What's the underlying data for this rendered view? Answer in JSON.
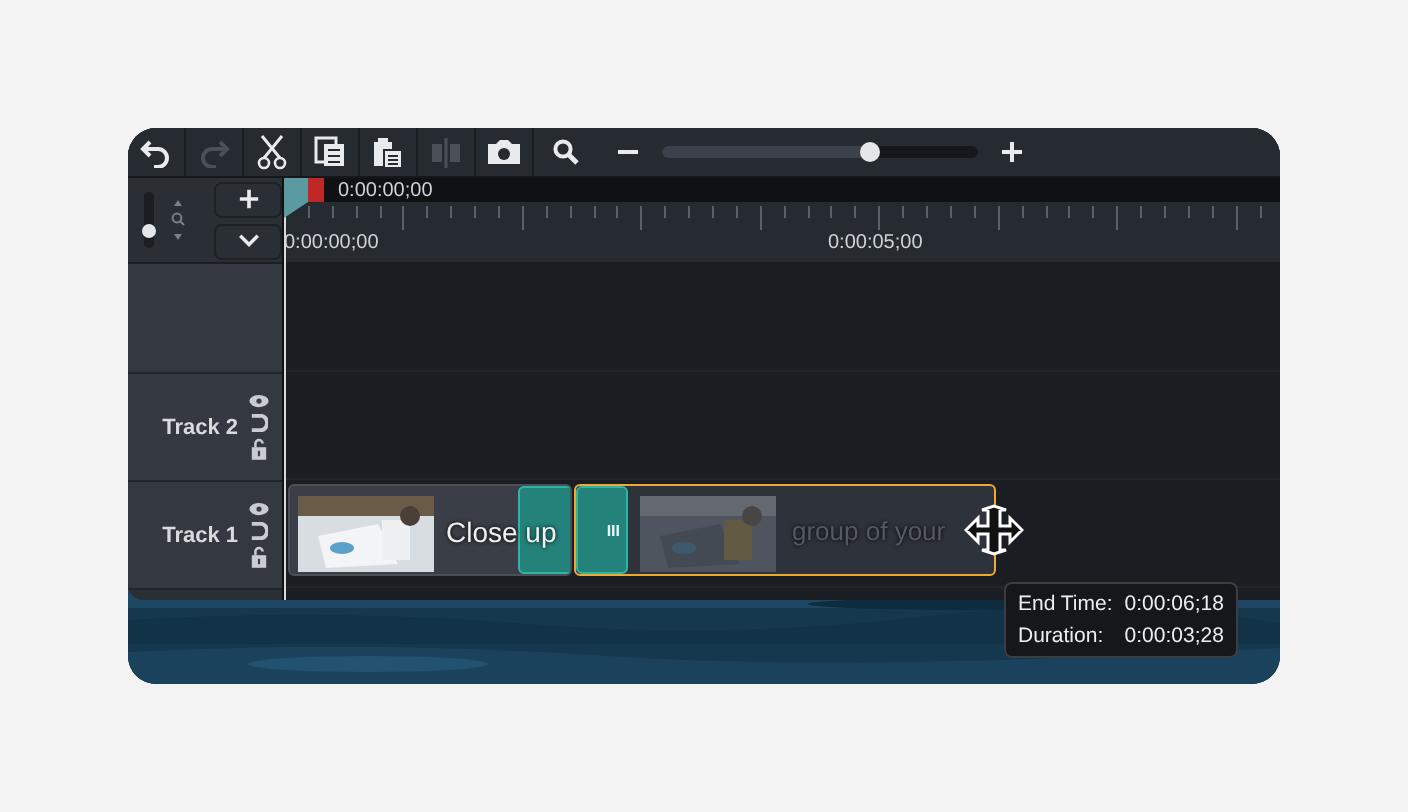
{
  "toolbar": {
    "tools": [
      {
        "kind": "undo",
        "disabled": false
      },
      {
        "kind": "redo",
        "disabled": true
      },
      {
        "kind": "cut",
        "disabled": false
      },
      {
        "kind": "copy",
        "disabled": false
      },
      {
        "kind": "paste",
        "disabled": false
      },
      {
        "kind": "split",
        "disabled": true
      },
      {
        "kind": "snapshot",
        "disabled": false
      }
    ],
    "zoom": {
      "level": 0.66
    }
  },
  "track_height": {
    "level": 0.3
  },
  "playhead": {
    "time": "0:00:00;00"
  },
  "ruler": {
    "labels": [
      "0:00:00;00",
      "0:00:05;00"
    ]
  },
  "tracks": [
    {
      "name": "Track 2"
    },
    {
      "name": "Track 1",
      "clips": [
        {
          "label": "Close up",
          "selected": false
        },
        {
          "label": "group of your",
          "selected": true,
          "transition_mark": "III"
        }
      ]
    }
  ],
  "tooltip": {
    "rows": [
      {
        "label": "End Time:",
        "value": "0:00:06;18"
      },
      {
        "label": "Duration:",
        "value": "0:00:03;28"
      }
    ]
  }
}
